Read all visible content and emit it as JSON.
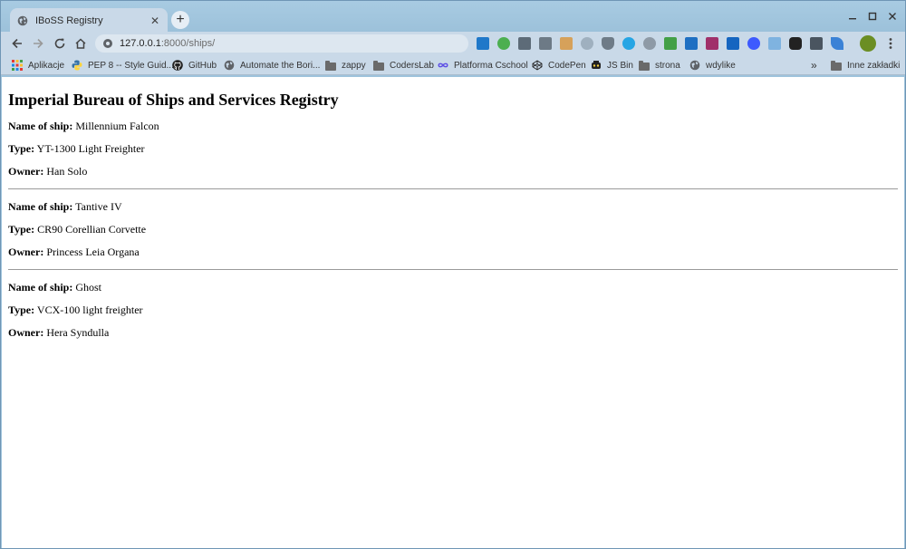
{
  "browser": {
    "tab": {
      "title": "IBoSS Registry"
    },
    "url": {
      "host": "127.0.0.1",
      "path": ":8000/ships/"
    },
    "bookmarks": [
      {
        "label": "Aplikacje",
        "icon": "apps-grid-icon"
      },
      {
        "label": "PEP 8 -- Style Guid...",
        "icon": "python-icon"
      },
      {
        "label": "GitHub",
        "icon": "github-icon"
      },
      {
        "label": "Automate the Bori...",
        "icon": "globe-icon"
      },
      {
        "label": "zappy",
        "icon": "folder-icon"
      },
      {
        "label": "CodersLab",
        "icon": "folder-icon"
      },
      {
        "label": "Platforma Cschool",
        "icon": "infinity-icon"
      },
      {
        "label": "CodePen",
        "icon": "codepen-icon"
      },
      {
        "label": "JS Bin",
        "icon": "jsbin-icon"
      },
      {
        "label": "strona",
        "icon": "folder-icon"
      },
      {
        "label": "wdylike",
        "icon": "globe-icon"
      }
    ],
    "bookmarks_overflow": "»",
    "other_bookmarks": "Inne zakładki"
  },
  "page": {
    "title": "Imperial Bureau of Ships and Services Registry",
    "labels": {
      "name": "Name of ship:",
      "type": "Type:",
      "owner": "Owner:"
    },
    "ships": [
      {
        "name": "Millennium Falcon",
        "type": "YT-1300 Light Freighter",
        "owner": "Han Solo"
      },
      {
        "name": "Tantive IV",
        "type": "CR90 Corellian Corvette",
        "owner": "Princess Leia Organa"
      },
      {
        "name": "Ghost",
        "type": "VCX-100 light freighter",
        "owner": "Hera Syndulla"
      }
    ]
  }
}
